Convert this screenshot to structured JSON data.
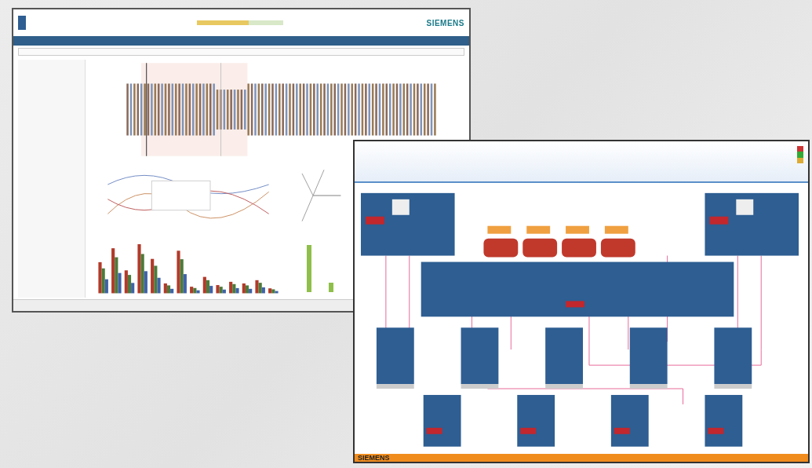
{
  "windows": [
    {
      "kind": "analyzer",
      "logo": "SIEMENS",
      "time_slider": {
        "level": 0.6
      }
    },
    {
      "kind": "diagram",
      "footer_logo": "SIEMENS"
    }
  ]
}
